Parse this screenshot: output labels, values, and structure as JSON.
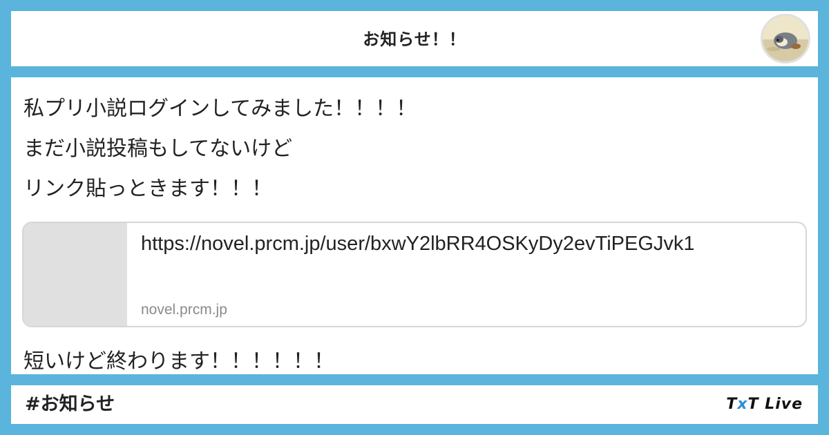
{
  "header": {
    "title": "お知らせ！！"
  },
  "post": {
    "lines": [
      "私プリ小説ログインしてみました！！！！",
      "まだ小説投稿もしてないけど",
      "リンク貼っときます！！！",
      "短いけど終わります！！！！！！"
    ],
    "link_card": {
      "url": "https://novel.prcm.jp/user/bxwY2lbRR4OSKyDy2evTiPEGJvk1",
      "domain": "novel.prcm.jp"
    }
  },
  "footer": {
    "hashtag": "#お知らせ",
    "brand_t1": "T",
    "brand_x": "x",
    "brand_t2": "T",
    "brand_live": " Live"
  },
  "colors": {
    "frame": "#5ab4dc",
    "brand_accent": "#2a8fd6"
  },
  "icons": {
    "avatar": "user-avatar-image"
  }
}
